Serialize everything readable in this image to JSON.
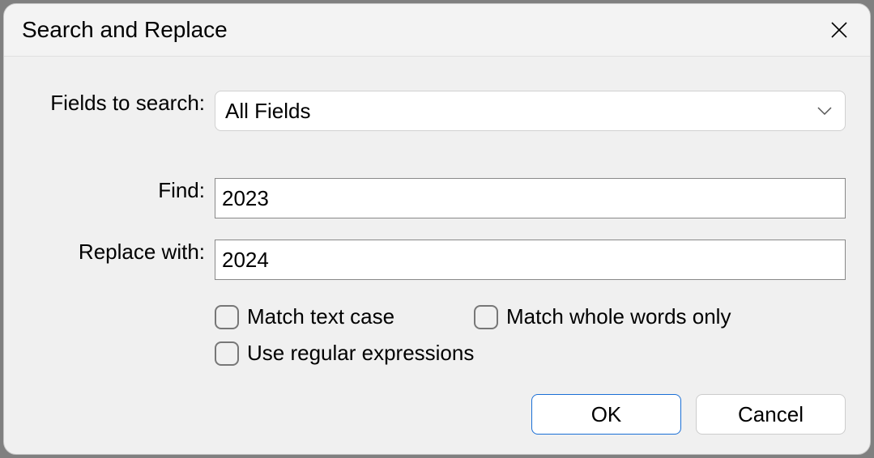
{
  "dialog": {
    "title": "Search and Replace"
  },
  "labels": {
    "fields_to_search": "Fields to search:",
    "find": "Find:",
    "replace_with": "Replace with:"
  },
  "fields": {
    "dropdown_value": "All Fields",
    "find_value": "2023",
    "replace_value": "2024"
  },
  "options": {
    "match_case": "Match text case",
    "whole_words": "Match whole words only",
    "regex": "Use regular expressions"
  },
  "buttons": {
    "ok": "OK",
    "cancel": "Cancel"
  }
}
